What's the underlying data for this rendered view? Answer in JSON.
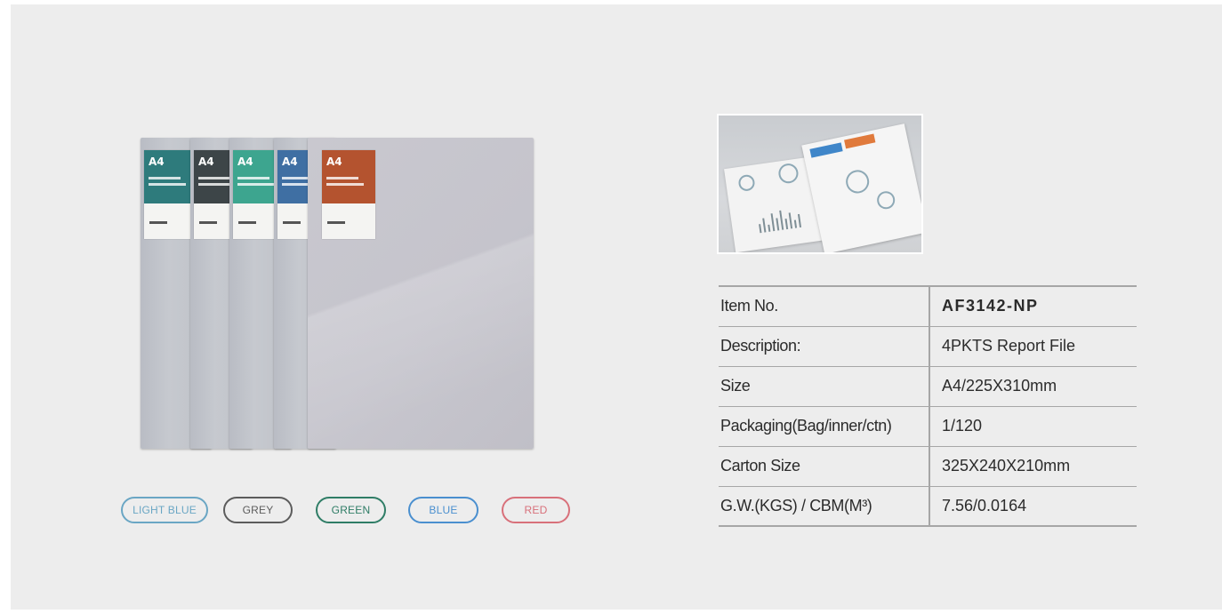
{
  "colors": {
    "panel_bg": "#ededed",
    "light_blue": "#6aa6c4",
    "grey": "#5c5c5c",
    "green": "#2f7d66",
    "blue": "#4a8fcf",
    "red": "#d8707a"
  },
  "product_photo": {
    "folders": [
      {
        "color": "#2e7b7c",
        "card_label": "A4"
      },
      {
        "color": "#3d4548",
        "card_label": "A4"
      },
      {
        "color": "#3da58f",
        "card_label": "A4"
      },
      {
        "color": "#3f6fa3",
        "card_label": "A4"
      },
      {
        "color": "#b4532f",
        "card_label": "A4"
      }
    ]
  },
  "color_options": [
    {
      "label": "LIGHT BLUE"
    },
    {
      "label": "GREY"
    },
    {
      "label": "GREEN"
    },
    {
      "label": "BLUE"
    },
    {
      "label": "RED"
    }
  ],
  "specs": [
    {
      "key": "Item No.",
      "value": "AF3142-NP"
    },
    {
      "key": "Description:",
      "value": "4PKTS Report File"
    },
    {
      "key": "Size",
      "value": "A4/225X310mm"
    },
    {
      "key": "Packaging(Bag/inner/ctn)",
      "value": "1/120"
    },
    {
      "key": "Carton Size",
      "value": "325X240X210mm"
    },
    {
      "key": "G.W.(KGS) / CBM(M³)",
      "value": "7.56/0.0164"
    }
  ]
}
